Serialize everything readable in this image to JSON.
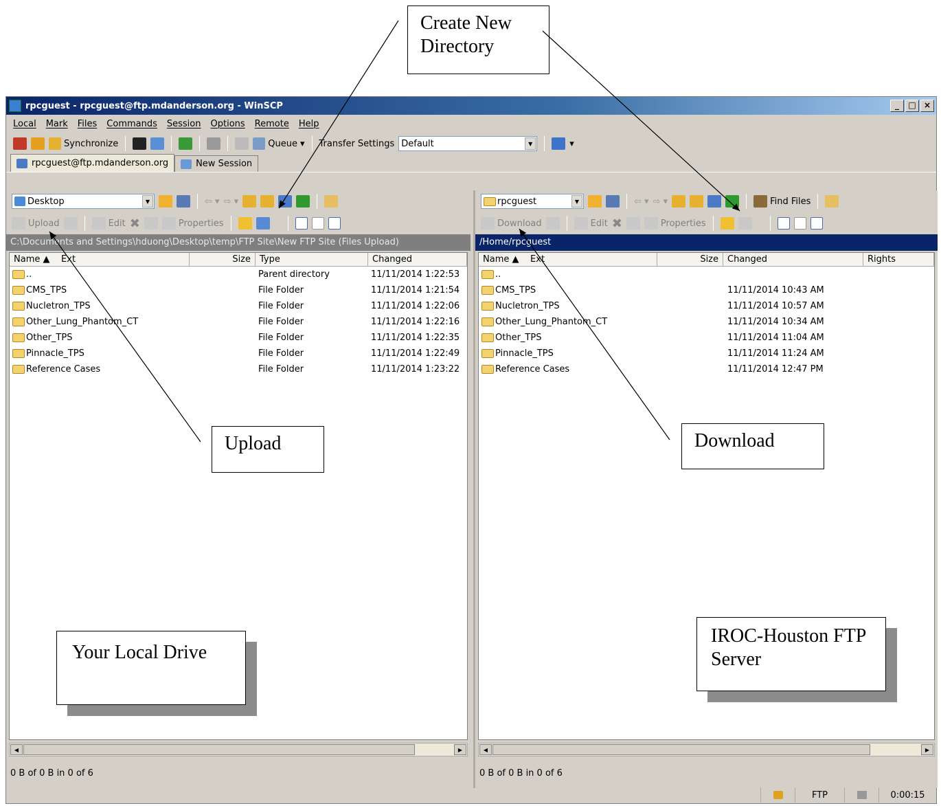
{
  "window": {
    "title": "rpcguest - rpcguest@ftp.mdanderson.org - WinSCP"
  },
  "menu": [
    "Local",
    "Mark",
    "Files",
    "Commands",
    "Session",
    "Options",
    "Remote",
    "Help"
  ],
  "toolbar": {
    "synchronize": "Synchronize",
    "queue": "Queue",
    "transfer_label": "Transfer Settings",
    "transfer_value": "Default"
  },
  "tabs": [
    {
      "label": "rpcguest@ftp.mdanderson.org"
    },
    {
      "label": "New Session"
    }
  ],
  "local": {
    "drive": "Desktop",
    "upload": "Upload",
    "edit": "Edit",
    "properties": "Properties",
    "path": "C:\\Documents and Settings\\hduong\\Desktop\\temp\\FTP Site\\New FTP Site (Files Upload)",
    "columns": [
      "Name",
      "Ext",
      "Size",
      "Type",
      "Changed"
    ],
    "rows": [
      {
        "name": "..",
        "type": "Parent directory",
        "changed": "11/11/2014  1:22:53"
      },
      {
        "name": "CMS_TPS",
        "type": "File Folder",
        "changed": "11/11/2014  1:21:54"
      },
      {
        "name": "Nucletron_TPS",
        "type": "File Folder",
        "changed": "11/11/2014  1:22:06"
      },
      {
        "name": "Other_Lung_Phantom_CT",
        "type": "File Folder",
        "changed": "11/11/2014  1:22:16"
      },
      {
        "name": "Other_TPS",
        "type": "File Folder",
        "changed": "11/11/2014  1:22:35"
      },
      {
        "name": "Pinnacle_TPS",
        "type": "File Folder",
        "changed": "11/11/2014  1:22:49"
      },
      {
        "name": "Reference Cases",
        "type": "File Folder",
        "changed": "11/11/2014  1:23:22"
      }
    ],
    "status": "0 B of 0 B in 0 of 6"
  },
  "remote": {
    "drive": "rpcguest",
    "find_files": "Find Files",
    "download": "Download",
    "edit": "Edit",
    "properties": "Properties",
    "path": "/Home/rpcguest",
    "columns": [
      "Name",
      "Ext",
      "Size",
      "Changed",
      "Rights"
    ],
    "rows": [
      {
        "name": "..",
        "changed": ""
      },
      {
        "name": "CMS_TPS",
        "changed": "11/11/2014 10:43 AM"
      },
      {
        "name": "Nucletron_TPS",
        "changed": "11/11/2014 10:57 AM"
      },
      {
        "name": "Other_Lung_Phantom_CT",
        "changed": "11/11/2014 10:34 AM"
      },
      {
        "name": "Other_TPS",
        "changed": "11/11/2014 11:04 AM"
      },
      {
        "name": "Pinnacle_TPS",
        "changed": "11/11/2014 11:24 AM"
      },
      {
        "name": "Reference Cases",
        "changed": "11/11/2014 12:47 PM"
      }
    ],
    "status": "0 B of 0 B in 0 of 6"
  },
  "statusbar": {
    "protocol": "FTP",
    "time": "0:00:15"
  },
  "callouts": {
    "create_dir": "Create New Directory",
    "upload": "Upload",
    "download": "Download",
    "local_drive": "Your Local Drive",
    "server": "IROC-Houston FTP Server"
  },
  "icons": [
    "lock-icon",
    "folder-icon",
    "home-icon",
    "refresh-icon",
    "filter-icon",
    "new-folder-icon"
  ]
}
